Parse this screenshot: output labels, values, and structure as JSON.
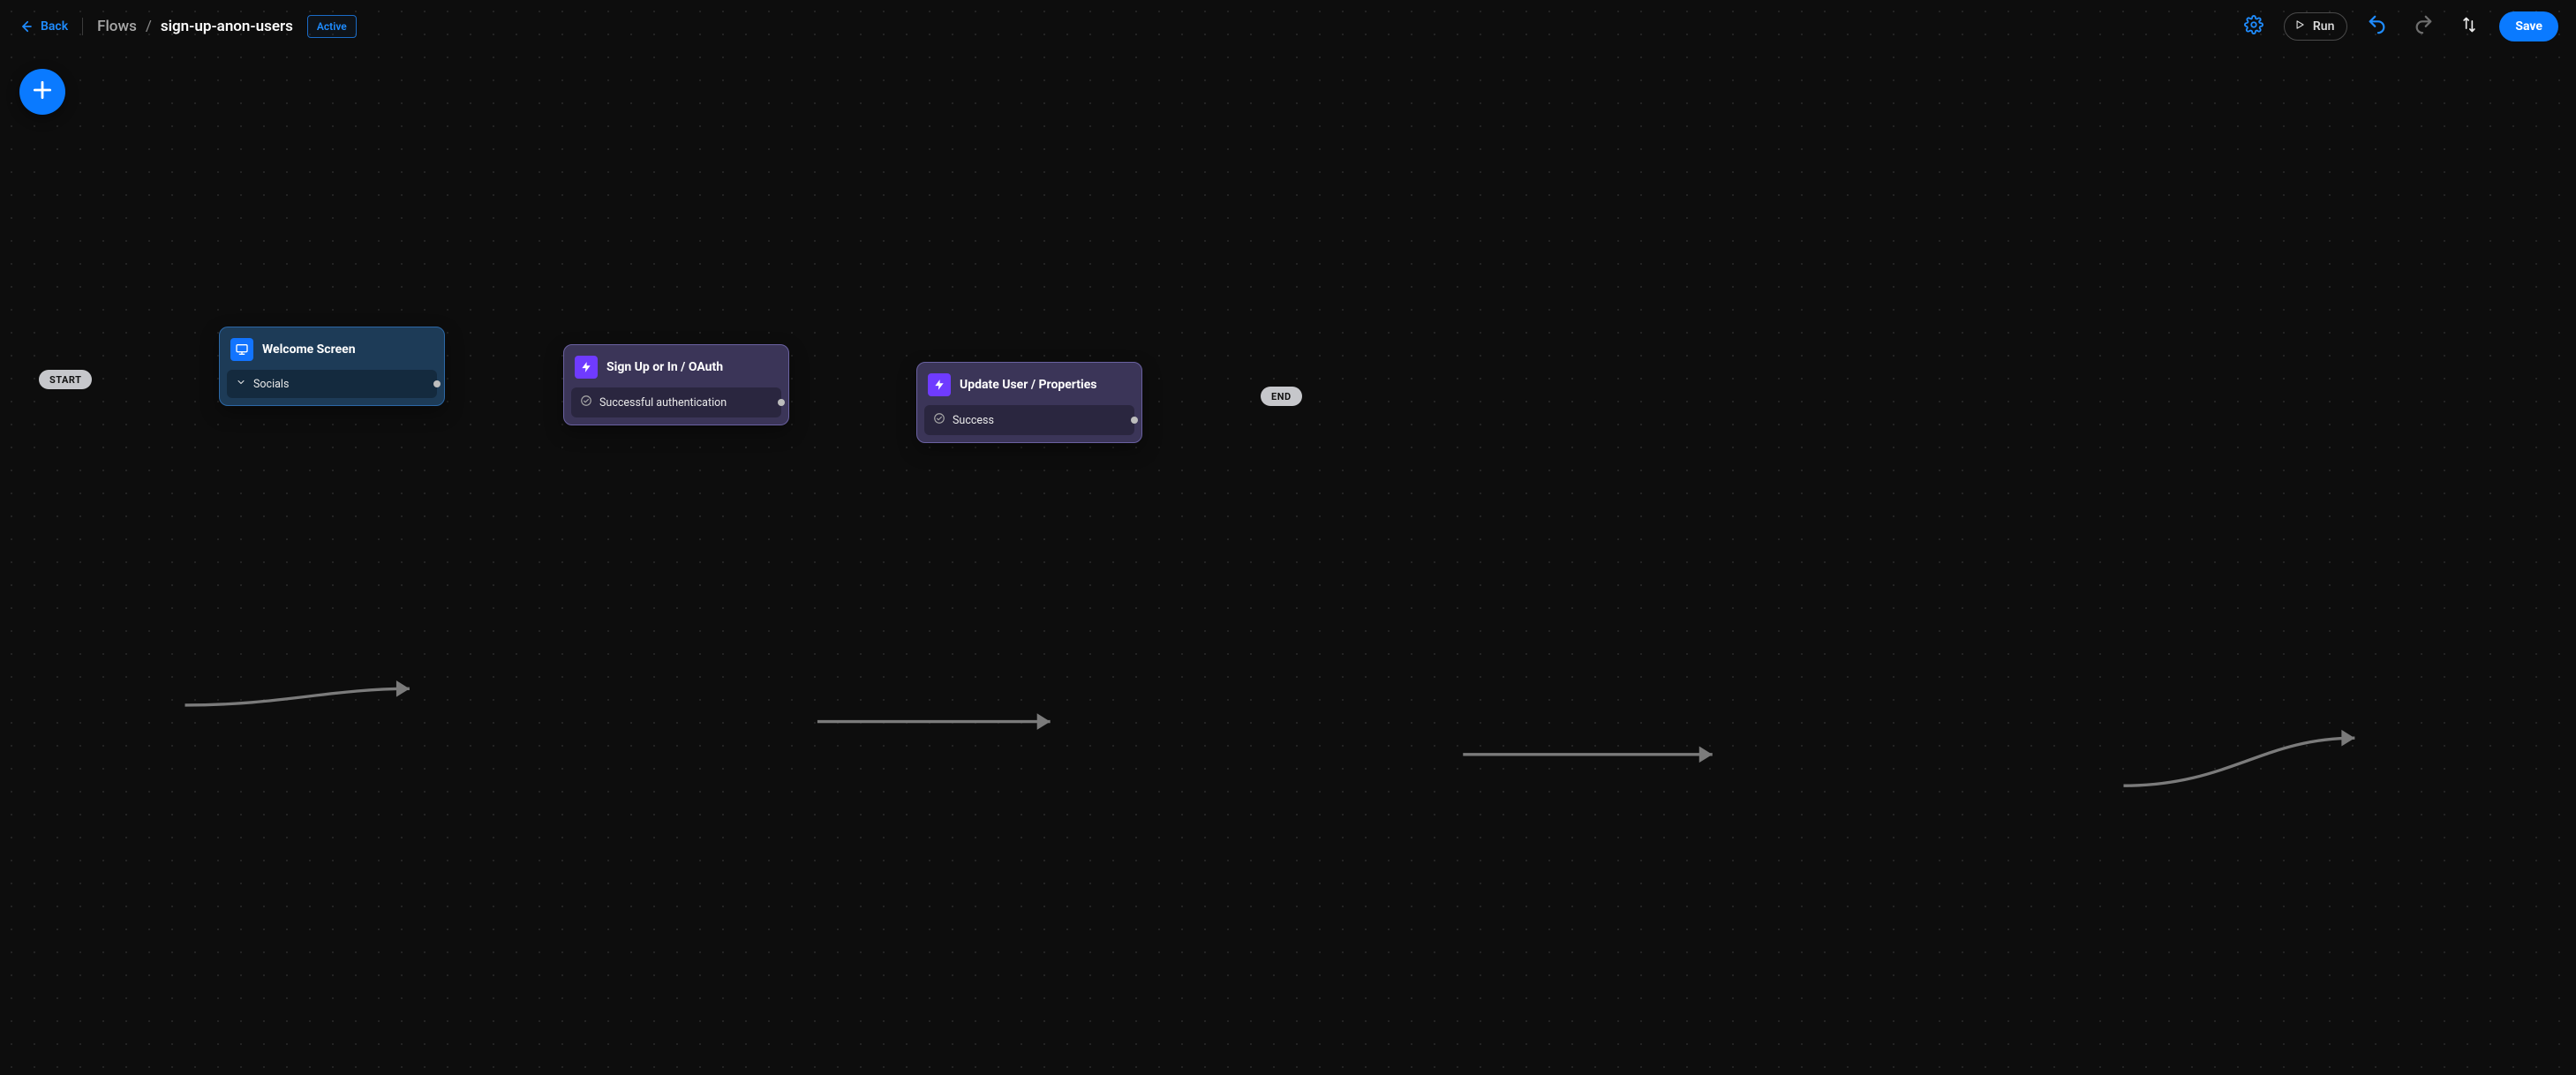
{
  "header": {
    "back_label": "Back",
    "breadcrumb_root": "Flows",
    "breadcrumb_separator": "/",
    "breadcrumb_current": "sign-up-anon-users",
    "status": "Active",
    "run_label": "Run",
    "save_label": "Save"
  },
  "canvas": {
    "start_label": "START",
    "end_label": "END"
  },
  "nodes": {
    "welcome": {
      "title": "Welcome Screen",
      "row_label": "Socials"
    },
    "signup": {
      "title": "Sign Up or In / OAuth",
      "row_label": "Successful authentication"
    },
    "update": {
      "title": "Update User / Properties",
      "row_label": "Success"
    }
  }
}
